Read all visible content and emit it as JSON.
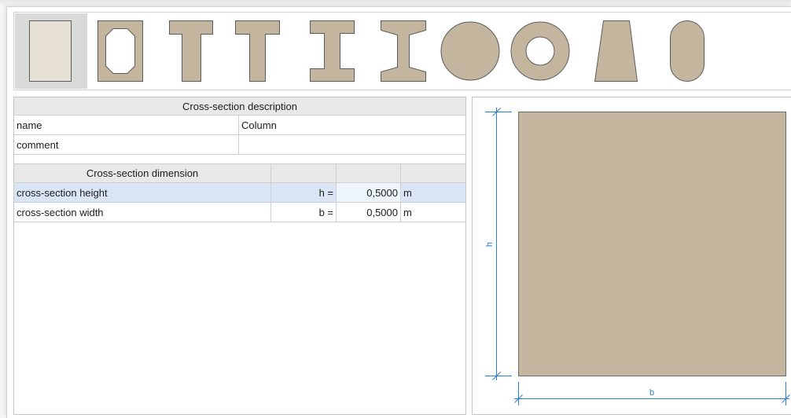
{
  "toolbar": {
    "shapes": [
      {
        "icon": "rectangle-section-icon",
        "selected": true
      },
      {
        "icon": "hollow-box-section-icon",
        "selected": false
      },
      {
        "icon": "t-section-icon",
        "selected": false
      },
      {
        "icon": "t-section-thin-web-icon",
        "selected": false
      },
      {
        "icon": "i-section-icon",
        "selected": false
      },
      {
        "icon": "i-section-tapered-flange-icon",
        "selected": false
      },
      {
        "icon": "circle-section-icon",
        "selected": false
      },
      {
        "icon": "ring-section-icon",
        "selected": false
      },
      {
        "icon": "trapezoid-section-icon",
        "selected": false
      },
      {
        "icon": "oval-section-icon",
        "selected": false
      }
    ]
  },
  "description": {
    "header": "Cross-section description",
    "rows": [
      {
        "label": "name",
        "value": "Column"
      },
      {
        "label": "comment",
        "value": ""
      }
    ]
  },
  "dimensions": {
    "header": "Cross-section dimension",
    "rows": [
      {
        "label": "cross-section height",
        "symbol": "h =",
        "value": "0,5000",
        "unit": "m",
        "selected": true
      },
      {
        "label": "cross-section width",
        "symbol": "b =",
        "value": "0,5000",
        "unit": "m",
        "selected": false
      }
    ]
  },
  "drawing": {
    "height_label": "h",
    "width_label": "b"
  },
  "colors": {
    "shape_fill": "#c4b59f",
    "selected_shape_fill": "#e7e0d4",
    "shape_stroke": "#5c5c5c",
    "dimension": "#2a80d5",
    "selected_row": "#d9e5f4",
    "selected_cell": "#eef4fb",
    "header_bg": "#e8e8e8",
    "selected_button_bg": "#d9d9d9"
  }
}
